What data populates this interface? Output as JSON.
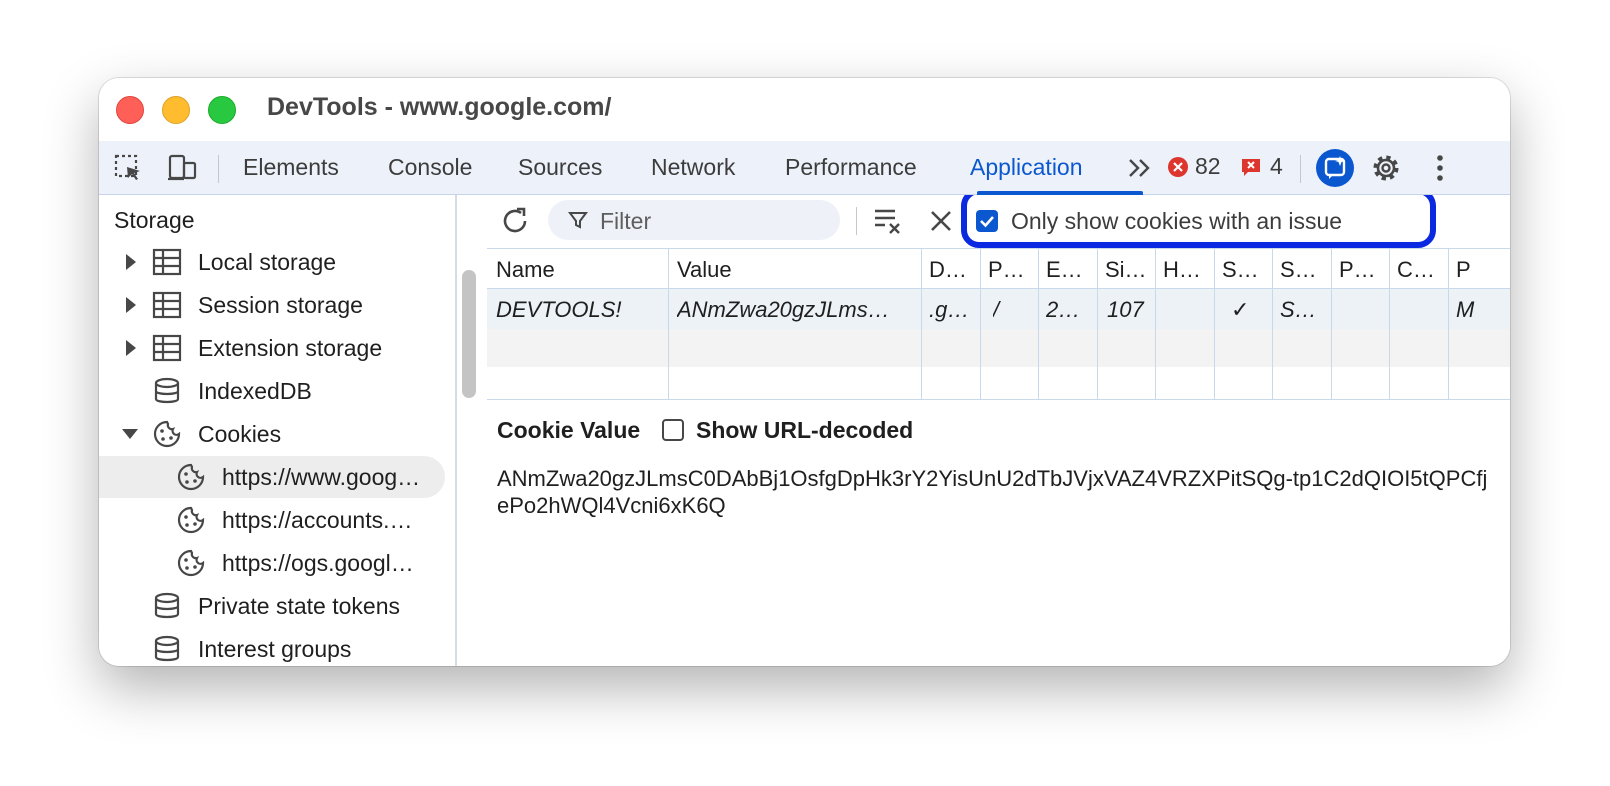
{
  "window": {
    "title": "DevTools - www.google.com/"
  },
  "toolbar": {
    "tabs": [
      "Elements",
      "Console",
      "Sources",
      "Network",
      "Performance",
      "Application"
    ],
    "active_tab": "Application",
    "more_tabs_label": "»",
    "errors_count": "82",
    "issues_count": "4"
  },
  "sidebar": {
    "heading": "Storage",
    "items": [
      {
        "label": "Local storage",
        "icon": "table-icon"
      },
      {
        "label": "Session storage",
        "icon": "table-icon"
      },
      {
        "label": "Extension storage",
        "icon": "table-icon"
      },
      {
        "label": "IndexedDB",
        "icon": "database-icon"
      },
      {
        "label": "Cookies",
        "icon": "cookie-icon"
      },
      {
        "label": "https://www.goog…",
        "icon": "cookie-icon"
      },
      {
        "label": "https://accounts.…",
        "icon": "cookie-icon"
      },
      {
        "label": "https://ogs.googl…",
        "icon": "cookie-icon"
      },
      {
        "label": "Private state tokens",
        "icon": "database-icon"
      },
      {
        "label": "Interest groups",
        "icon": "database-icon"
      }
    ]
  },
  "filter_bar": {
    "filter_placeholder": "Filter",
    "only_issues_label": "Only show cookies with an issue",
    "only_issues_checked": true
  },
  "table": {
    "columns": [
      "Name",
      "Value",
      "D…",
      "P…",
      "E…",
      "Si…",
      "H…",
      "S…",
      "S…",
      "P…",
      "C…",
      "P"
    ],
    "rows": [
      [
        "DEVTOOLS!",
        "ANmZwa20gzJLms…",
        ".g…",
        "/",
        "2…",
        "107",
        "",
        "✓",
        "S…",
        "",
        "",
        "M"
      ]
    ]
  },
  "cookie_value": {
    "title": "Cookie Value",
    "show_decoded_label": "Show URL-decoded",
    "show_decoded_checked": false,
    "value": "ANmZwa20gzJLmsC0DAbBj1OsfgDpHk3rY2YisUnU2dTbJVjxVAZ4VRZXPitSQg-tp1C2dQIOI5tQPCfjePo2hWQl4Vcni6xK6Q"
  },
  "colors": {
    "accent": "#0b57d0",
    "highlight": "#0a29e0",
    "error": "#dc362e"
  }
}
